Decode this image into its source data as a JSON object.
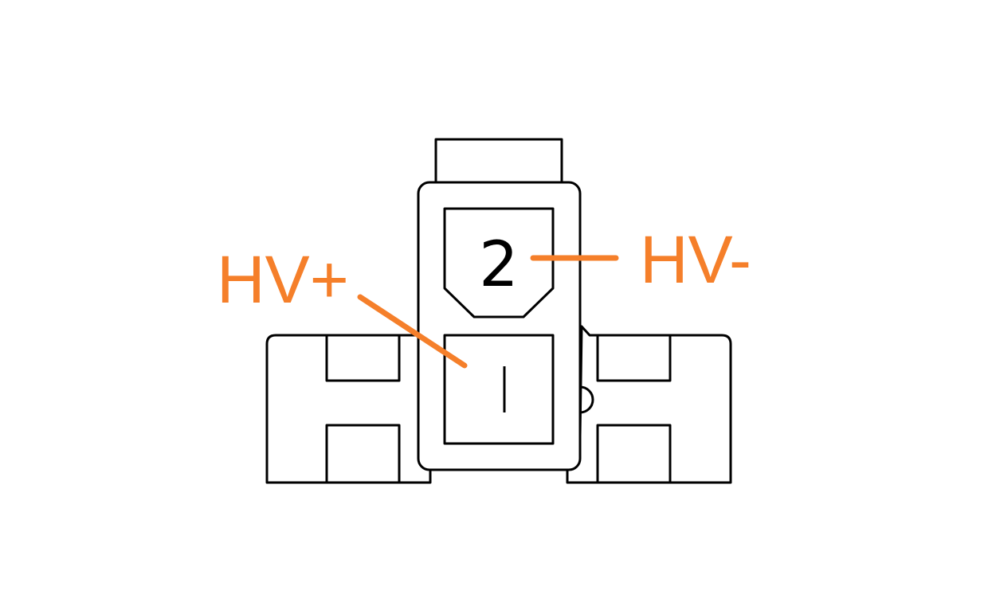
{
  "diagram": {
    "pins": [
      {
        "number": "2",
        "label": "HV-"
      },
      {
        "number": "1",
        "label": "HV+"
      }
    ]
  },
  "colors": {
    "outline": "#000000",
    "label": "#f57f2a",
    "background": "#ffffff"
  }
}
